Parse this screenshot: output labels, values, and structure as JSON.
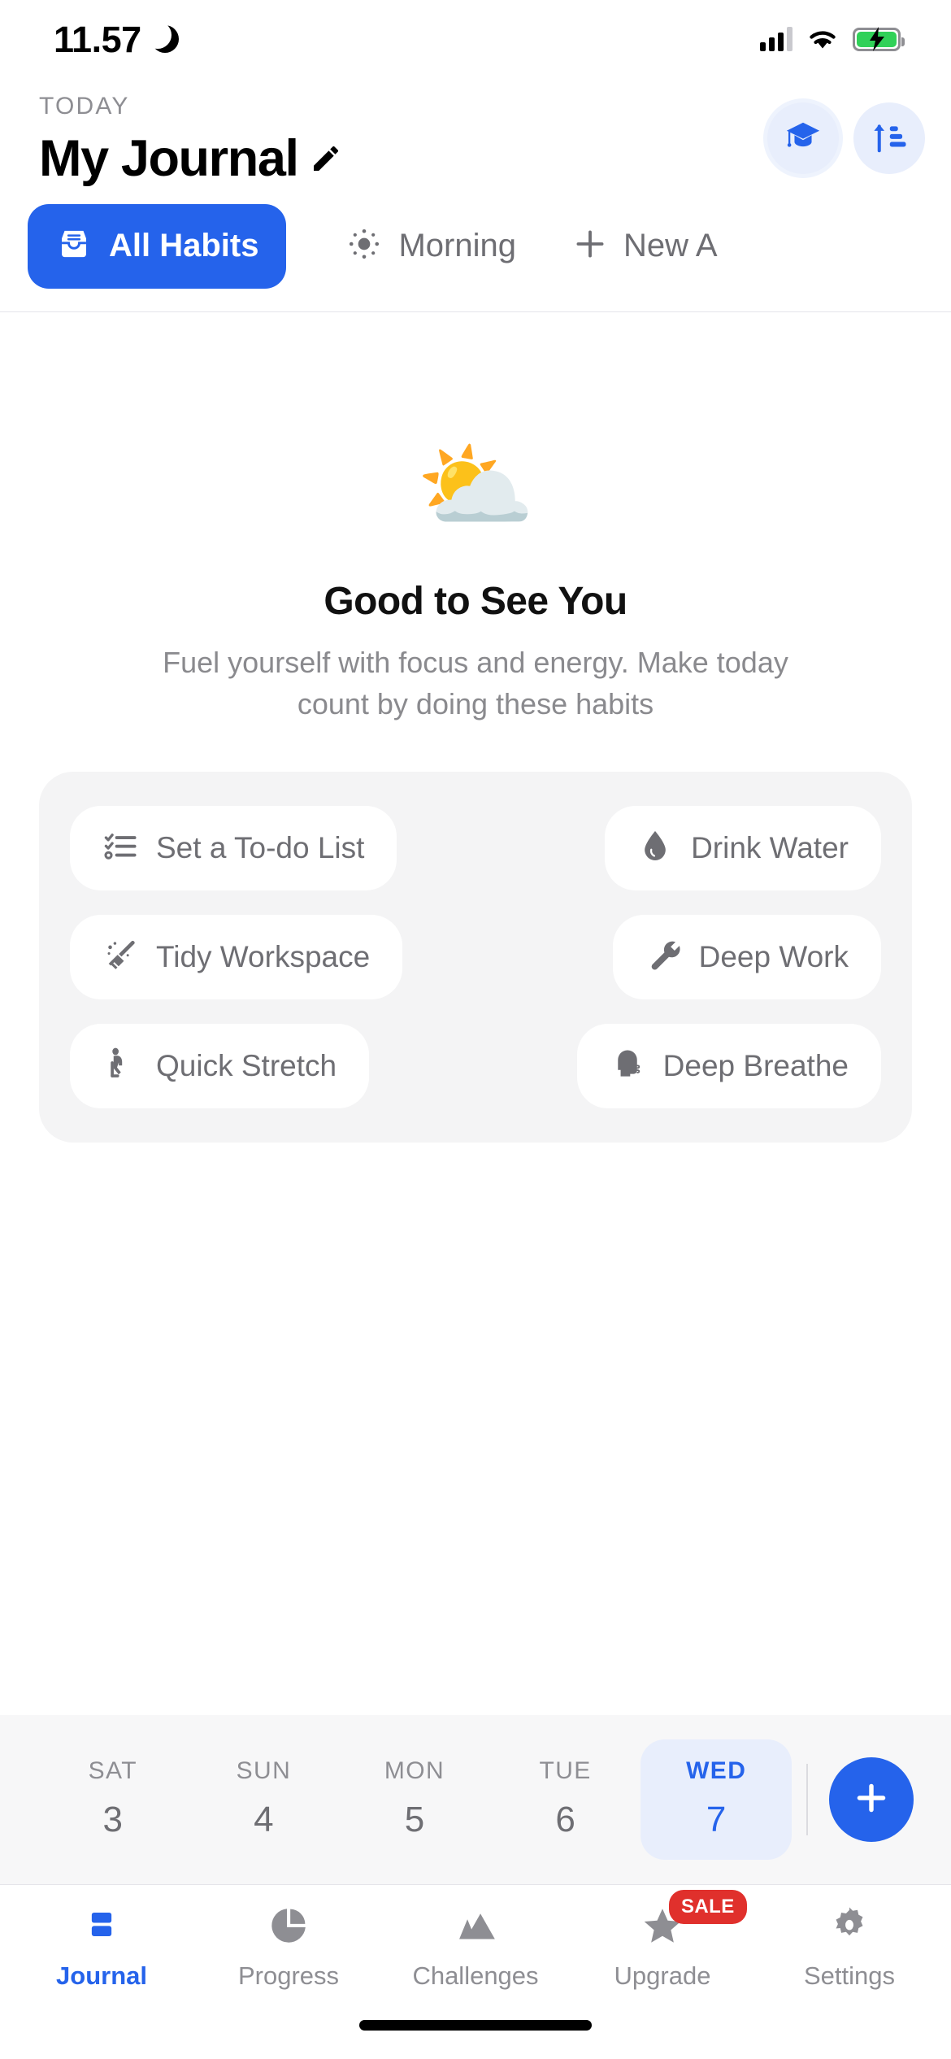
{
  "status_bar": {
    "time": "11.57",
    "moon_icon": "crescent-moon-icon",
    "signal_icon": "cellular-signal-icon",
    "wifi_icon": "wifi-icon",
    "battery_icon": "battery-charging-icon",
    "battery_color": "#30d158"
  },
  "header": {
    "eyebrow": "TODAY",
    "title": "My Journal",
    "edit_icon": "pencil-icon",
    "actions": [
      {
        "name": "learn-button",
        "icon": "graduation-cap-icon"
      },
      {
        "name": "sort-button",
        "icon": "sort-ascending-icon"
      }
    ]
  },
  "tabs": [
    {
      "label": "All Habits",
      "icon": "inbox-icon",
      "active": true
    },
    {
      "label": "Morning",
      "icon": "sun-icon",
      "active": false
    },
    {
      "label": "New A",
      "icon": "plus-icon",
      "active": false
    }
  ],
  "empty_state": {
    "emoji": "⛅",
    "emoji_name": "sun-behind-cloud-emoji",
    "title": "Good to See You",
    "subtitle": "Fuel yourself with focus and energy. Make today count by doing these habits"
  },
  "suggestions": [
    [
      {
        "label": "Set a To-do List",
        "icon": "checklist-icon"
      },
      {
        "label": "Drink Water",
        "icon": "water-drop-icon"
      }
    ],
    [
      {
        "label": "Tidy Workspace",
        "icon": "broom-icon"
      },
      {
        "label": "Deep Work",
        "icon": "wrench-icon"
      }
    ],
    [
      {
        "label": "Quick Stretch",
        "icon": "stretching-person-icon"
      },
      {
        "label": "Deep Breathe",
        "icon": "breathing-head-icon"
      }
    ]
  ],
  "date_strip": {
    "days": [
      {
        "dow": "SAT",
        "num": "3",
        "selected": false
      },
      {
        "dow": "SUN",
        "num": "4",
        "selected": false
      },
      {
        "dow": "MON",
        "num": "5",
        "selected": false
      },
      {
        "dow": "TUE",
        "num": "6",
        "selected": false
      },
      {
        "dow": "WED",
        "num": "7",
        "selected": true
      }
    ],
    "add_button_icon": "plus-icon"
  },
  "bottom_nav": [
    {
      "label": "Journal",
      "icon": "journal-icon",
      "active": true
    },
    {
      "label": "Progress",
      "icon": "pie-chart-icon",
      "active": false
    },
    {
      "label": "Challenges",
      "icon": "mountains-icon",
      "active": false
    },
    {
      "label": "Upgrade",
      "icon": "star-icon",
      "active": false,
      "badge": "SALE"
    },
    {
      "label": "Settings",
      "icon": "gear-icon",
      "active": false
    }
  ],
  "colors": {
    "accent": "#2563eb",
    "accent_soft": "#e8eefc",
    "muted_text": "#8e8e93",
    "panel_bg": "#f4f4f5",
    "badge_red": "#e0302c"
  }
}
